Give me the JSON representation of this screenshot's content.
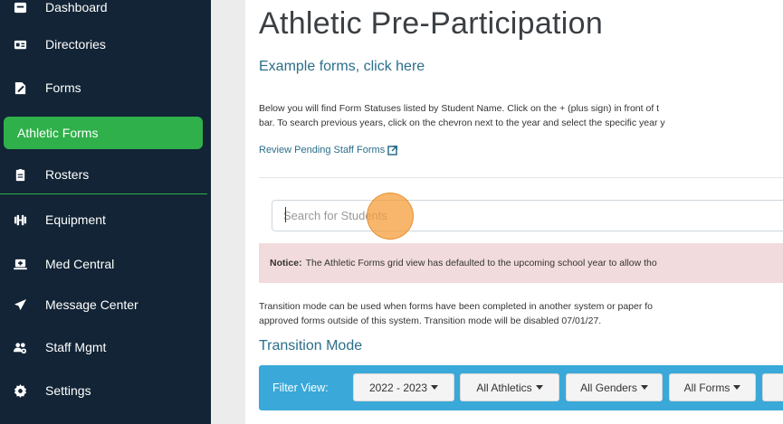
{
  "sidebar": {
    "items": [
      {
        "label": "Dashboard",
        "icon": "dashboard-icon"
      },
      {
        "label": "Directories",
        "icon": "id-card-icon"
      },
      {
        "label": "Forms",
        "icon": "signature-icon"
      },
      {
        "label": "Athletic Forms",
        "icon": "",
        "active": true
      },
      {
        "label": "Rosters",
        "icon": "clipboard-icon"
      },
      {
        "label": "Equipment",
        "icon": "dumbbell-icon"
      },
      {
        "label": "Med Central",
        "icon": "laptop-medical-icon"
      },
      {
        "label": "Message Center",
        "icon": "paper-plane-icon"
      },
      {
        "label": "Staff Mgmt",
        "icon": "users-cog-icon"
      },
      {
        "label": "Settings",
        "icon": "gear-icon"
      }
    ]
  },
  "main": {
    "title": "Athletic Pre-Participation",
    "example_link": "Example forms, click here",
    "description_line1": "Below you will find Form Statuses listed by Student Name. Click on the + (plus sign) in front of t",
    "description_line2": "bar. To search previous years, click on the chevron next to the year and select the specific year y",
    "review_link": "Review Pending Staff Forms",
    "search_placeholder": "Search for Students",
    "notice_label": "Notice:",
    "notice_text": "The Athletic Forms grid view has defaulted to the upcoming school year to allow tho",
    "transition_line1": "Transition mode can be used when forms have been completed in another system or paper fo",
    "transition_line2": "approved forms outside of this system. Transition mode will be disabled 07/01/27.",
    "transition_title": "Transition Mode"
  },
  "filter": {
    "label": "Filter View:",
    "year": "2022 - 2023",
    "athletics": "All Athletics",
    "genders": "All Genders",
    "forms": "All Forms"
  },
  "colors": {
    "sidebar_bg": "#122436",
    "active_green": "#2fb04a",
    "filter_bar": "#3aa8d8",
    "link": "#2b6e8a",
    "notice_bg": "#f2dbdc"
  }
}
